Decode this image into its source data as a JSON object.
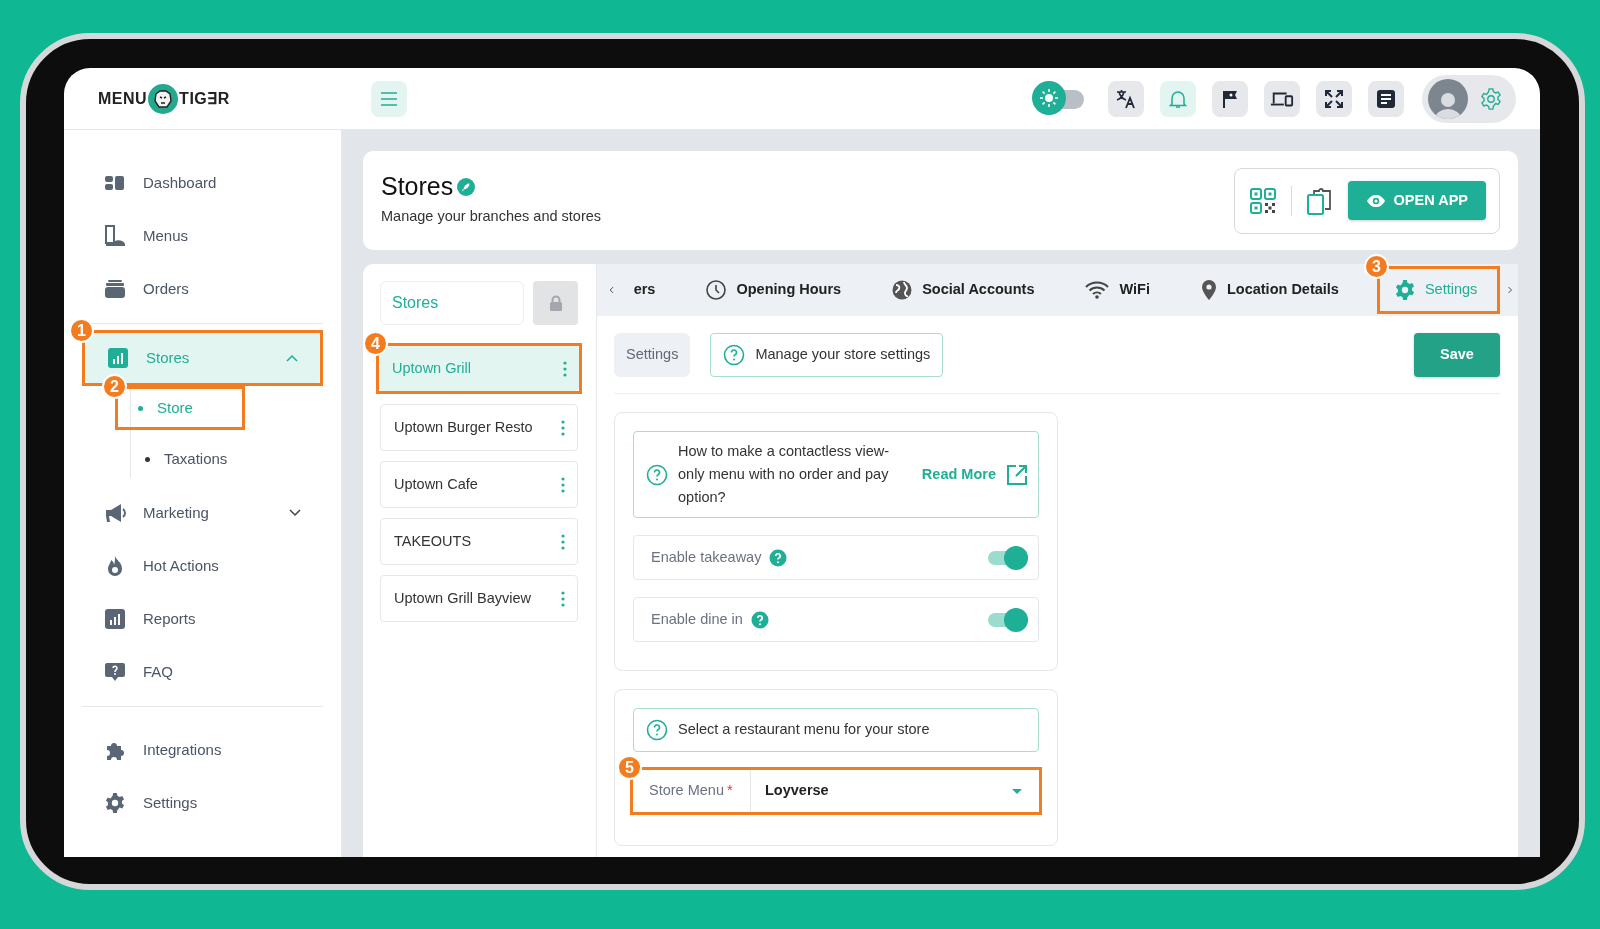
{
  "topbar": {
    "logo": {
      "left": "MENU",
      "right": "TIG∃R"
    },
    "dark_mode": false,
    "icons": [
      {
        "kind": "translate",
        "active": false
      },
      {
        "kind": "bell",
        "active": true
      },
      {
        "kind": "flag",
        "active": false
      },
      {
        "kind": "devices",
        "active": false
      },
      {
        "kind": "fullscreen",
        "active": false
      },
      {
        "kind": "document",
        "active": false
      }
    ]
  },
  "sidebar": {
    "groups": [
      [
        {
          "label": "Dashboard",
          "kind": "dashboard",
          "selected": false
        },
        {
          "label": "Menus",
          "kind": "menus",
          "selected": false
        },
        {
          "label": "Orders",
          "kind": "orders",
          "selected": false
        }
      ],
      [
        {
          "label": "Stores",
          "kind": "stores",
          "selected": true,
          "expanded": true,
          "callout": "1",
          "children": [
            {
              "label": "Store",
              "selected": true,
              "callout": "2"
            },
            {
              "label": "Taxations",
              "selected": false
            }
          ]
        },
        {
          "label": "Marketing",
          "kind": "marketing",
          "selected": false,
          "expanded": false
        },
        {
          "label": "Hot Actions",
          "kind": "fire",
          "selected": false
        },
        {
          "label": "Reports",
          "kind": "reports",
          "selected": false
        },
        {
          "label": "FAQ",
          "kind": "faq",
          "selected": false
        }
      ],
      [
        {
          "label": "Integrations",
          "kind": "puzzle",
          "selected": false
        },
        {
          "label": "Settings",
          "kind": "gear",
          "selected": false
        }
      ]
    ]
  },
  "header": {
    "title": "Stores",
    "subtitle": "Manage your branches and stores",
    "open_app": "OPEN APP"
  },
  "stores_panel": {
    "heading": "Stores",
    "locked": true,
    "stores": [
      {
        "name": "Uptown Grill",
        "selected": true,
        "callout": "4"
      },
      {
        "name": "Uptown Burger Resto",
        "selected": false
      },
      {
        "name": "Uptown Cafe",
        "selected": false
      },
      {
        "name": "TAKEOUTS",
        "selected": false
      },
      {
        "name": "Uptown Grill Bayview",
        "selected": false
      }
    ]
  },
  "tabs": [
    {
      "label": "ers",
      "kind": "plain",
      "selected": false
    },
    {
      "label": "Opening Hours",
      "kind": "clock",
      "selected": false
    },
    {
      "label": "Social Accounts",
      "kind": "globe",
      "selected": false
    },
    {
      "label": "WiFi",
      "kind": "wifi",
      "selected": false
    },
    {
      "label": "Location Details",
      "kind": "pin",
      "selected": false
    },
    {
      "label": "Settings",
      "kind": "gear",
      "selected": true,
      "callout": "3"
    }
  ],
  "settings": {
    "section_chip": "Settings",
    "info": "Manage your store settings",
    "save": "Save",
    "help": {
      "text": "How to make a contactless view-only menu with no order and pay option?",
      "link": "Read More"
    },
    "toggles": [
      {
        "label": "Enable takeaway",
        "on": true
      },
      {
        "label": "Enable dine in",
        "on": true
      }
    ],
    "menu_info": "Select a restaurant menu for your store",
    "store_menu": {
      "label": "Store Menu",
      "required_mark": "*",
      "value": "Loyverse",
      "callout": "5"
    }
  }
}
